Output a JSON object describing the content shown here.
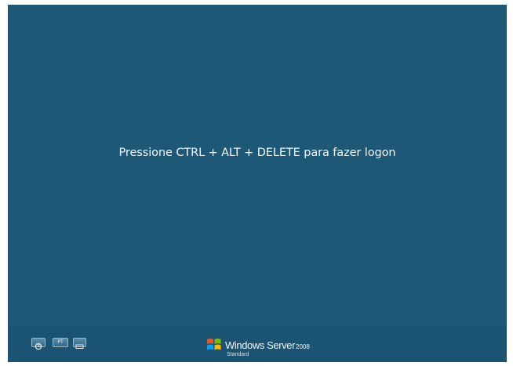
{
  "screen": {
    "background": "#1e5877",
    "prompt_text": "Pressione CTRL + ALT + DELETE para fazer logon"
  },
  "bottom_bar": {
    "buttons": [
      {
        "icon": "ease-of-access-icon"
      },
      {
        "label": "PT",
        "icon": "language-icon"
      },
      {
        "icon": "keyboard-icon"
      }
    ],
    "brand": {
      "name": "Windows Server",
      "version": "2008",
      "edition": "Standard",
      "logo_icon": "windows-flag-icon"
    }
  }
}
